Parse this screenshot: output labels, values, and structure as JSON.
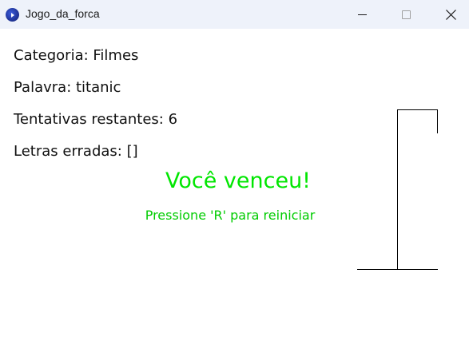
{
  "window": {
    "title": "Jogo_da_forca",
    "icon": "app-icon",
    "controls": [
      "minimize-icon",
      "maximize-icon",
      "close-icon"
    ]
  },
  "game": {
    "category_line": "Categoria: Filmes",
    "word_line": "Palavra: titanic",
    "attempts_line": "Tentativas restantes: 6",
    "wrong_letters_line": "Letras erradas: []",
    "win_message": "Você venceu!",
    "restart_hint": "Pressione 'R' para reiniciar"
  },
  "colors": {
    "win_text": "#00e600",
    "hint_text": "#00cc00",
    "titlebar_bg": "#eef2fa"
  }
}
